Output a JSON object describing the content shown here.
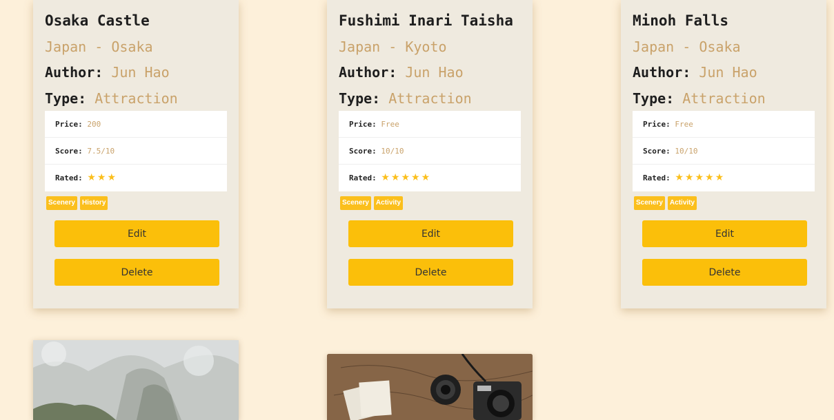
{
  "cards": [
    {
      "title": "Osaka Castle",
      "location": "Japan - Osaka",
      "author_label": "Author:",
      "author": "Jun Hao",
      "type_label": "Type:",
      "type": "Attraction",
      "price_label": "Price:",
      "price": "200",
      "score_label": "Score:",
      "score": "7.5/10",
      "rated_label": "Rated:",
      "stars": "★★★",
      "rating": 3,
      "tags": [
        "Scenery",
        "History"
      ],
      "edit_label": "Edit",
      "delete_label": "Delete"
    },
    {
      "title": "Fushimi Inari Taisha",
      "location": "Japan - Kyoto",
      "author_label": "Author:",
      "author": "Jun Hao",
      "type_label": "Type:",
      "type": "Attraction",
      "price_label": "Price:",
      "price": "Free",
      "score_label": "Score:",
      "score": "10/10",
      "rated_label": "Rated:",
      "stars": "★★★★★",
      "rating": 5,
      "tags": [
        "Scenery",
        "Activity"
      ],
      "edit_label": "Edit",
      "delete_label": "Delete"
    },
    {
      "title": "Minoh Falls",
      "location": "Japan - Osaka",
      "author_label": "Author:",
      "author": "Jun Hao",
      "type_label": "Type:",
      "type": "Attraction",
      "price_label": "Price:",
      "price": "Free",
      "score_label": "Score:",
      "score": "10/10",
      "rated_label": "Rated:",
      "stars": "★★★★★",
      "rating": 5,
      "tags": [
        "Scenery",
        "Activity"
      ],
      "edit_label": "Edit",
      "delete_label": "Delete"
    }
  ],
  "colors": {
    "background": "#fdf0da",
    "card": "#efeadf",
    "accent": "#fbbf0a",
    "muted_text": "#c9a26a"
  }
}
